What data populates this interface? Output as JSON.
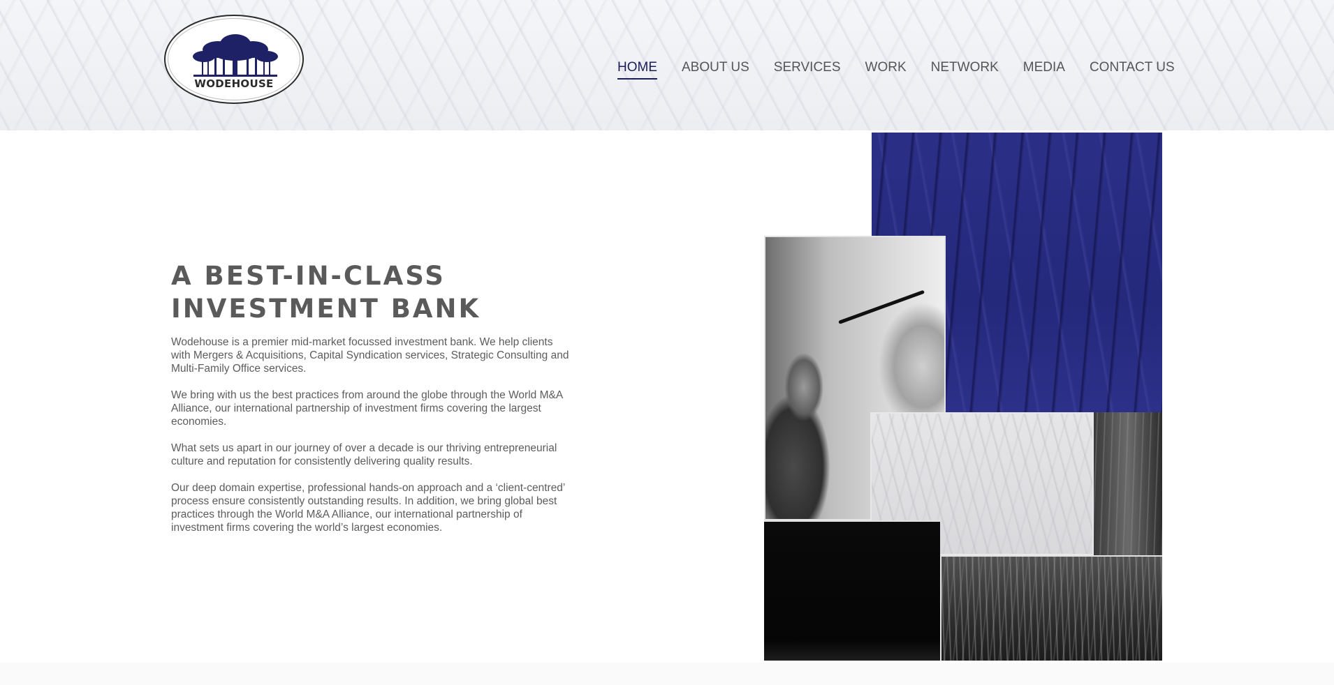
{
  "brand": {
    "logo_text": "WODEHOUSE",
    "accent_color": "#1d1d5a",
    "logo_tree_color": "#1e2166"
  },
  "nav": {
    "items": [
      {
        "label": "HOME",
        "active": true
      },
      {
        "label": "ABOUT US",
        "active": false
      },
      {
        "label": "SERVICES",
        "active": false
      },
      {
        "label": "WORK",
        "active": false
      },
      {
        "label": "NETWORK",
        "active": false
      },
      {
        "label": "MEDIA",
        "active": false
      },
      {
        "label": "CONTACT US",
        "active": false
      }
    ]
  },
  "hero": {
    "headline_line1": "A BEST-IN-CLASS",
    "headline_line2": "INVESTMENT BANK",
    "paragraphs": [
      "Wodehouse is a premier mid-market focussed investment bank. We help clients with Mergers & Acquisitions, Capital Syndication services, Strategic Consulting and Multi-Family Office services.",
      "We bring with us the best practices from around the globe through the World M&A Alliance, our international partnership of investment firms covering the largest economies.",
      "What sets us apart in our journey of over a decade is our thriving entrepreneurial culture and reputation for consistently delivering quality results.",
      "Our deep domain expertise, professional hands-on approach and a ‘client-centred’ process ensure consistently outstanding results. In addition, we bring global best practices through the World M&A Alliance, our international partnership of investment firms covering the world’s largest economies."
    ]
  }
}
